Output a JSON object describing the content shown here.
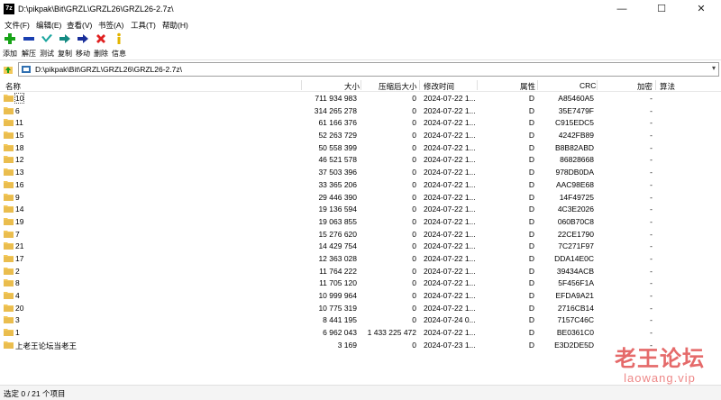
{
  "window": {
    "title": "D:\\pikpak\\Bit\\GRZL\\GRZL26\\GRZL26-2.7z\\",
    "app_icon": "7z",
    "min": "—",
    "max": "☐",
    "close": "✕"
  },
  "menu": [
    "文件(F)",
    "编辑(E)",
    "查看(V)",
    "书签(A)",
    "工具(T)",
    "帮助(H)"
  ],
  "toolbar": [
    {
      "label": "添加",
      "icon": "plus-icon",
      "color": "#17a317"
    },
    {
      "label": "解压",
      "icon": "minus-icon",
      "color": "#1a3fb0"
    },
    {
      "label": "测试",
      "icon": "check-icon",
      "color": "#1aa59e"
    },
    {
      "label": "复制",
      "icon": "copy-arrow-icon",
      "color": "#138a82"
    },
    {
      "label": "移动",
      "icon": "move-arrow-icon",
      "color": "#1a2f9a"
    },
    {
      "label": "删除",
      "icon": "delete-x-icon",
      "color": "#e02020"
    },
    {
      "label": "信息",
      "icon": "info-icon",
      "color": "#e3b400"
    }
  ],
  "address": {
    "path": "D:\\pikpak\\Bit\\GRZL\\GRZL26\\GRZL26-2.7z\\"
  },
  "columns": [
    "名称",
    "大小",
    "压缩后大小",
    "修改时间",
    "属性",
    "CRC",
    "加密",
    "算法"
  ],
  "rows": [
    {
      "name": "10",
      "size": "711 934 983",
      "packed": "0",
      "mtime": "2024-07-22 1...",
      "attr": "D",
      "crc": "A85460A5",
      "enc": "-"
    },
    {
      "name": "6",
      "size": "314 265 278",
      "packed": "0",
      "mtime": "2024-07-22 1...",
      "attr": "D",
      "crc": "35E7479F",
      "enc": "-"
    },
    {
      "name": "11",
      "size": "61 166 376",
      "packed": "0",
      "mtime": "2024-07-22 1...",
      "attr": "D",
      "crc": "C915EDC5",
      "enc": "-"
    },
    {
      "name": "15",
      "size": "52 263 729",
      "packed": "0",
      "mtime": "2024-07-22 1...",
      "attr": "D",
      "crc": "4242FB89",
      "enc": "-"
    },
    {
      "name": "18",
      "size": "50 558 399",
      "packed": "0",
      "mtime": "2024-07-22 1...",
      "attr": "D",
      "crc": "B8B82ABD",
      "enc": "-"
    },
    {
      "name": "12",
      "size": "46 521 578",
      "packed": "0",
      "mtime": "2024-07-22 1...",
      "attr": "D",
      "crc": "86828668",
      "enc": "-"
    },
    {
      "name": "13",
      "size": "37 503 396",
      "packed": "0",
      "mtime": "2024-07-22 1...",
      "attr": "D",
      "crc": "978DB0DA",
      "enc": "-"
    },
    {
      "name": "16",
      "size": "33 365 206",
      "packed": "0",
      "mtime": "2024-07-22 1...",
      "attr": "D",
      "crc": "AAC98E68",
      "enc": "-"
    },
    {
      "name": "9",
      "size": "29 446 390",
      "packed": "0",
      "mtime": "2024-07-22 1...",
      "attr": "D",
      "crc": "14F49725",
      "enc": "-"
    },
    {
      "name": "14",
      "size": "19 136 594",
      "packed": "0",
      "mtime": "2024-07-22 1...",
      "attr": "D",
      "crc": "4C3E2026",
      "enc": "-"
    },
    {
      "name": "19",
      "size": "19 063 855",
      "packed": "0",
      "mtime": "2024-07-22 1...",
      "attr": "D",
      "crc": "060B70C8",
      "enc": "-"
    },
    {
      "name": "7",
      "size": "15 276 620",
      "packed": "0",
      "mtime": "2024-07-22 1...",
      "attr": "D",
      "crc": "22CE1790",
      "enc": "-"
    },
    {
      "name": "21",
      "size": "14 429 754",
      "packed": "0",
      "mtime": "2024-07-22 1...",
      "attr": "D",
      "crc": "7C271F97",
      "enc": "-"
    },
    {
      "name": "17",
      "size": "12 363 028",
      "packed": "0",
      "mtime": "2024-07-22 1...",
      "attr": "D",
      "crc": "DDA14E0C",
      "enc": "-"
    },
    {
      "name": "2",
      "size": "11 764 222",
      "packed": "0",
      "mtime": "2024-07-22 1...",
      "attr": "D",
      "crc": "39434ACB",
      "enc": "-"
    },
    {
      "name": "8",
      "size": "11 705 120",
      "packed": "0",
      "mtime": "2024-07-22 1...",
      "attr": "D",
      "crc": "5F456F1A",
      "enc": "-"
    },
    {
      "name": "4",
      "size": "10 999 964",
      "packed": "0",
      "mtime": "2024-07-22 1...",
      "attr": "D",
      "crc": "EFDA9A21",
      "enc": "-"
    },
    {
      "name": "20",
      "size": "10 775 319",
      "packed": "0",
      "mtime": "2024-07-22 1...",
      "attr": "D",
      "crc": "2716CB14",
      "enc": "-"
    },
    {
      "name": "3",
      "size": "8 441 195",
      "packed": "0",
      "mtime": "2024-07-24 0...",
      "attr": "D",
      "crc": "7157C46C",
      "enc": "-"
    },
    {
      "name": "1",
      "size": "6 962 043",
      "packed": "1 433 225 472",
      "mtime": "2024-07-22 1...",
      "attr": "D",
      "crc": "BE0361C0",
      "enc": "-"
    },
    {
      "name": "上老王论坛当老王",
      "size": "3 169",
      "packed": "0",
      "mtime": "2024-07-23 1...",
      "attr": "D",
      "crc": "E3D2DE5D",
      "enc": "-"
    }
  ],
  "status": "选定 0 / 21 个项目",
  "watermark": {
    "line1": "老王论坛",
    "line2": "laowang.vip"
  },
  "colors": {
    "folder": "#f3c85a",
    "folder_dark": "#dba83a"
  }
}
